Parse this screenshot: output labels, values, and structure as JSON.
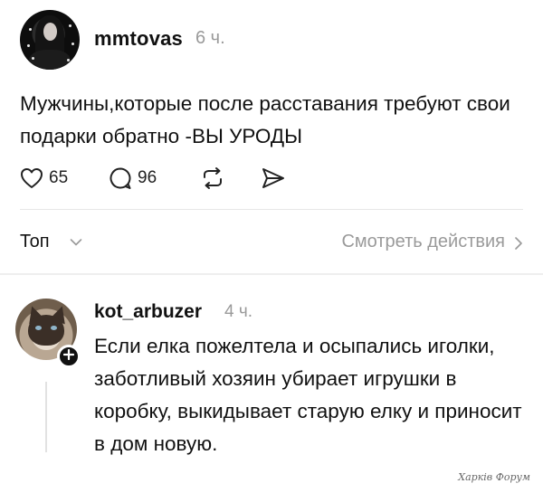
{
  "post": {
    "username": "mmtovas",
    "time": "6 ч.",
    "text": "Мужчины,которые после расставания требуют свои подарки обратно -ВЫ УРОДЫ",
    "likes": "65",
    "replies": "96"
  },
  "sort": {
    "label": "Топ",
    "view_actions": "Смотреть действия"
  },
  "reply": {
    "username": "kot_arbuzer",
    "time": "4 ч.",
    "text": "Если елка пожелтела и осыпались иголки, заботливый хозяин убирает игрушки в коробку, выкидывает старую елку и приносит в дом новую."
  },
  "watermark": "Харків Форум",
  "icons": {
    "like": "heart-icon",
    "reply": "comment-icon",
    "repost": "repost-icon",
    "share": "send-icon",
    "sort": "chevron-down-icon",
    "view": "chevron-right-icon",
    "follow": "plus-icon"
  },
  "colors": {
    "text": "#111111",
    "secondary": "#9a9a9a",
    "divider": "#e7e7e7"
  }
}
